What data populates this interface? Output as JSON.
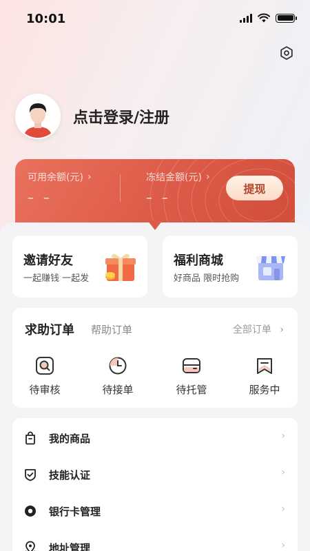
{
  "status_bar": {
    "time": "10:01"
  },
  "profile": {
    "login_label": "点击登录/注册"
  },
  "balance": {
    "available_label": "可用余额(元)",
    "available_value": "– –",
    "frozen_label": "冻结金额(元)",
    "frozen_value": "– –",
    "withdraw_label": "提现",
    "chevron": "›",
    "accent_color": "#dc5a47"
  },
  "promos": [
    {
      "title": "邀请好友",
      "subtitle": "一起赚钱 一起发",
      "icon": "gift-icon"
    },
    {
      "title": "福利商城",
      "subtitle": "好商品 限时抢购",
      "icon": "store-icon"
    }
  ],
  "orders": {
    "title": "求助订单",
    "tab": "帮助订单",
    "all_label": "全部订单",
    "chevron": "›",
    "items": [
      {
        "label": "待审核",
        "icon": "search-doc-icon"
      },
      {
        "label": "待接单",
        "icon": "clock-icon"
      },
      {
        "label": "待托管",
        "icon": "wallet-icon"
      },
      {
        "label": "服务中",
        "icon": "bookmark-icon"
      }
    ]
  },
  "menu": {
    "chevron": "›",
    "items": [
      {
        "label": "我的商品",
        "icon": "bag-icon"
      },
      {
        "label": "技能认证",
        "icon": "shield-check-icon"
      },
      {
        "label": "银行卡管理",
        "icon": "card-icon"
      },
      {
        "label": "地址管理",
        "icon": "location-icon"
      }
    ]
  }
}
